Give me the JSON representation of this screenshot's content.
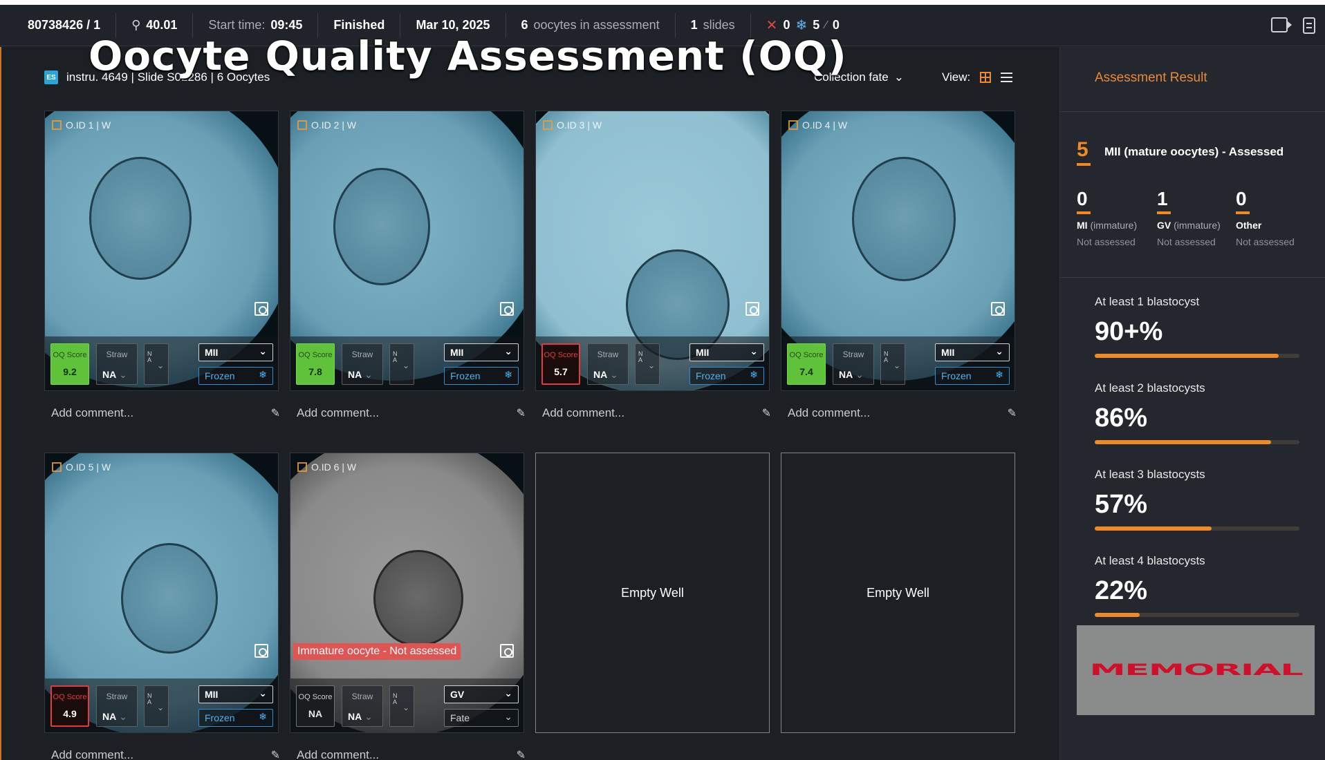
{
  "topbar": {
    "patient_id": "80738426 / 1",
    "age": "40.01",
    "start_label": "Start time:",
    "start_time": "09:45",
    "status": "Finished",
    "date": "Mar 10, 2025",
    "oocyte_count": "6",
    "oocyte_label": "oocytes in assessment",
    "slide_count": "1",
    "slide_label": "slides",
    "discard_count": "0",
    "frozen_count": "5",
    "other_count": "0"
  },
  "overlay_title": "Oocyte Quality Assessment (OQ)",
  "subbar": {
    "es_badge": "ES",
    "info": "instru. 4649 | Slide S02286 | 6 Oocytes",
    "collection_fate": "Collection fate",
    "view_label": "View:"
  },
  "wells": [
    {
      "id": "O.ID 1 | W",
      "score_label": "OQ Score",
      "score": "9.2",
      "straw_label": "Straw",
      "straw": "NA",
      "na_label": "NA",
      "maturity": "MII",
      "fate": "Frozen",
      "comment": "Add comment..."
    },
    {
      "id": "O.ID 2 | W",
      "score_label": "OQ Score",
      "score": "7.8",
      "straw_label": "Straw",
      "straw": "NA",
      "na_label": "NA",
      "maturity": "MII",
      "fate": "Frozen",
      "comment": "Add comment..."
    },
    {
      "id": "O.ID 3 | W",
      "score_label": "OQ Score",
      "score": "5.7",
      "straw_label": "Straw",
      "straw": "NA",
      "na_label": "NA",
      "maturity": "MII",
      "fate": "Frozen",
      "comment": "Add comment..."
    },
    {
      "id": "O.ID 4 | W",
      "score_label": "OQ Score",
      "score": "7.4",
      "straw_label": "Straw",
      "straw": "NA",
      "na_label": "NA",
      "maturity": "MII",
      "fate": "Frozen",
      "comment": "Add comment..."
    },
    {
      "id": "O.ID 5 | W",
      "score_label": "OQ Score",
      "score": "4.9",
      "straw_label": "Straw",
      "straw": "NA",
      "na_label": "NA",
      "maturity": "MII",
      "fate": "Frozen",
      "comment": "Add comment..."
    },
    {
      "id": "O.ID 6 | W",
      "score_label": "OQ Score",
      "score": "NA",
      "straw_label": "Straw",
      "straw": "NA",
      "na_label": "NA",
      "maturity": "GV",
      "fate": "Fate",
      "comment": "Add comment...",
      "warning": "Immature oocyte - Not assessed"
    }
  ],
  "empty_wells": [
    "Empty Well",
    "Empty Well"
  ],
  "sidebar": {
    "header": "Assessment Result",
    "mii_count": "5",
    "mii_title": "MII (mature oocytes) - Assessed",
    "groups": [
      {
        "count": "0",
        "name": "MI",
        "qual": "(immature)",
        "status": "Not assessed"
      },
      {
        "count": "1",
        "name": "GV",
        "qual": "(immature)",
        "status": "Not assessed"
      },
      {
        "count": "0",
        "name": "Other",
        "qual": "",
        "status": "Not assessed"
      }
    ],
    "stats": [
      {
        "label": "At least 1 blastocyst",
        "value": "90+%",
        "fill": 0.9
      },
      {
        "label": "At least 2 blastocysts",
        "value": "86%",
        "fill": 0.86
      },
      {
        "label": "At least 3 blastocysts",
        "value": "57%",
        "fill": 0.57
      },
      {
        "label": "At least 4 blastocysts",
        "value": "22%",
        "fill": 0.22
      }
    ],
    "logo": "MEMORIAL"
  },
  "colors": {
    "accent": "#f08a24",
    "score_good": "#5fc23a",
    "score_bad": "#e53b3b",
    "frozen": "#2f8ed8"
  }
}
